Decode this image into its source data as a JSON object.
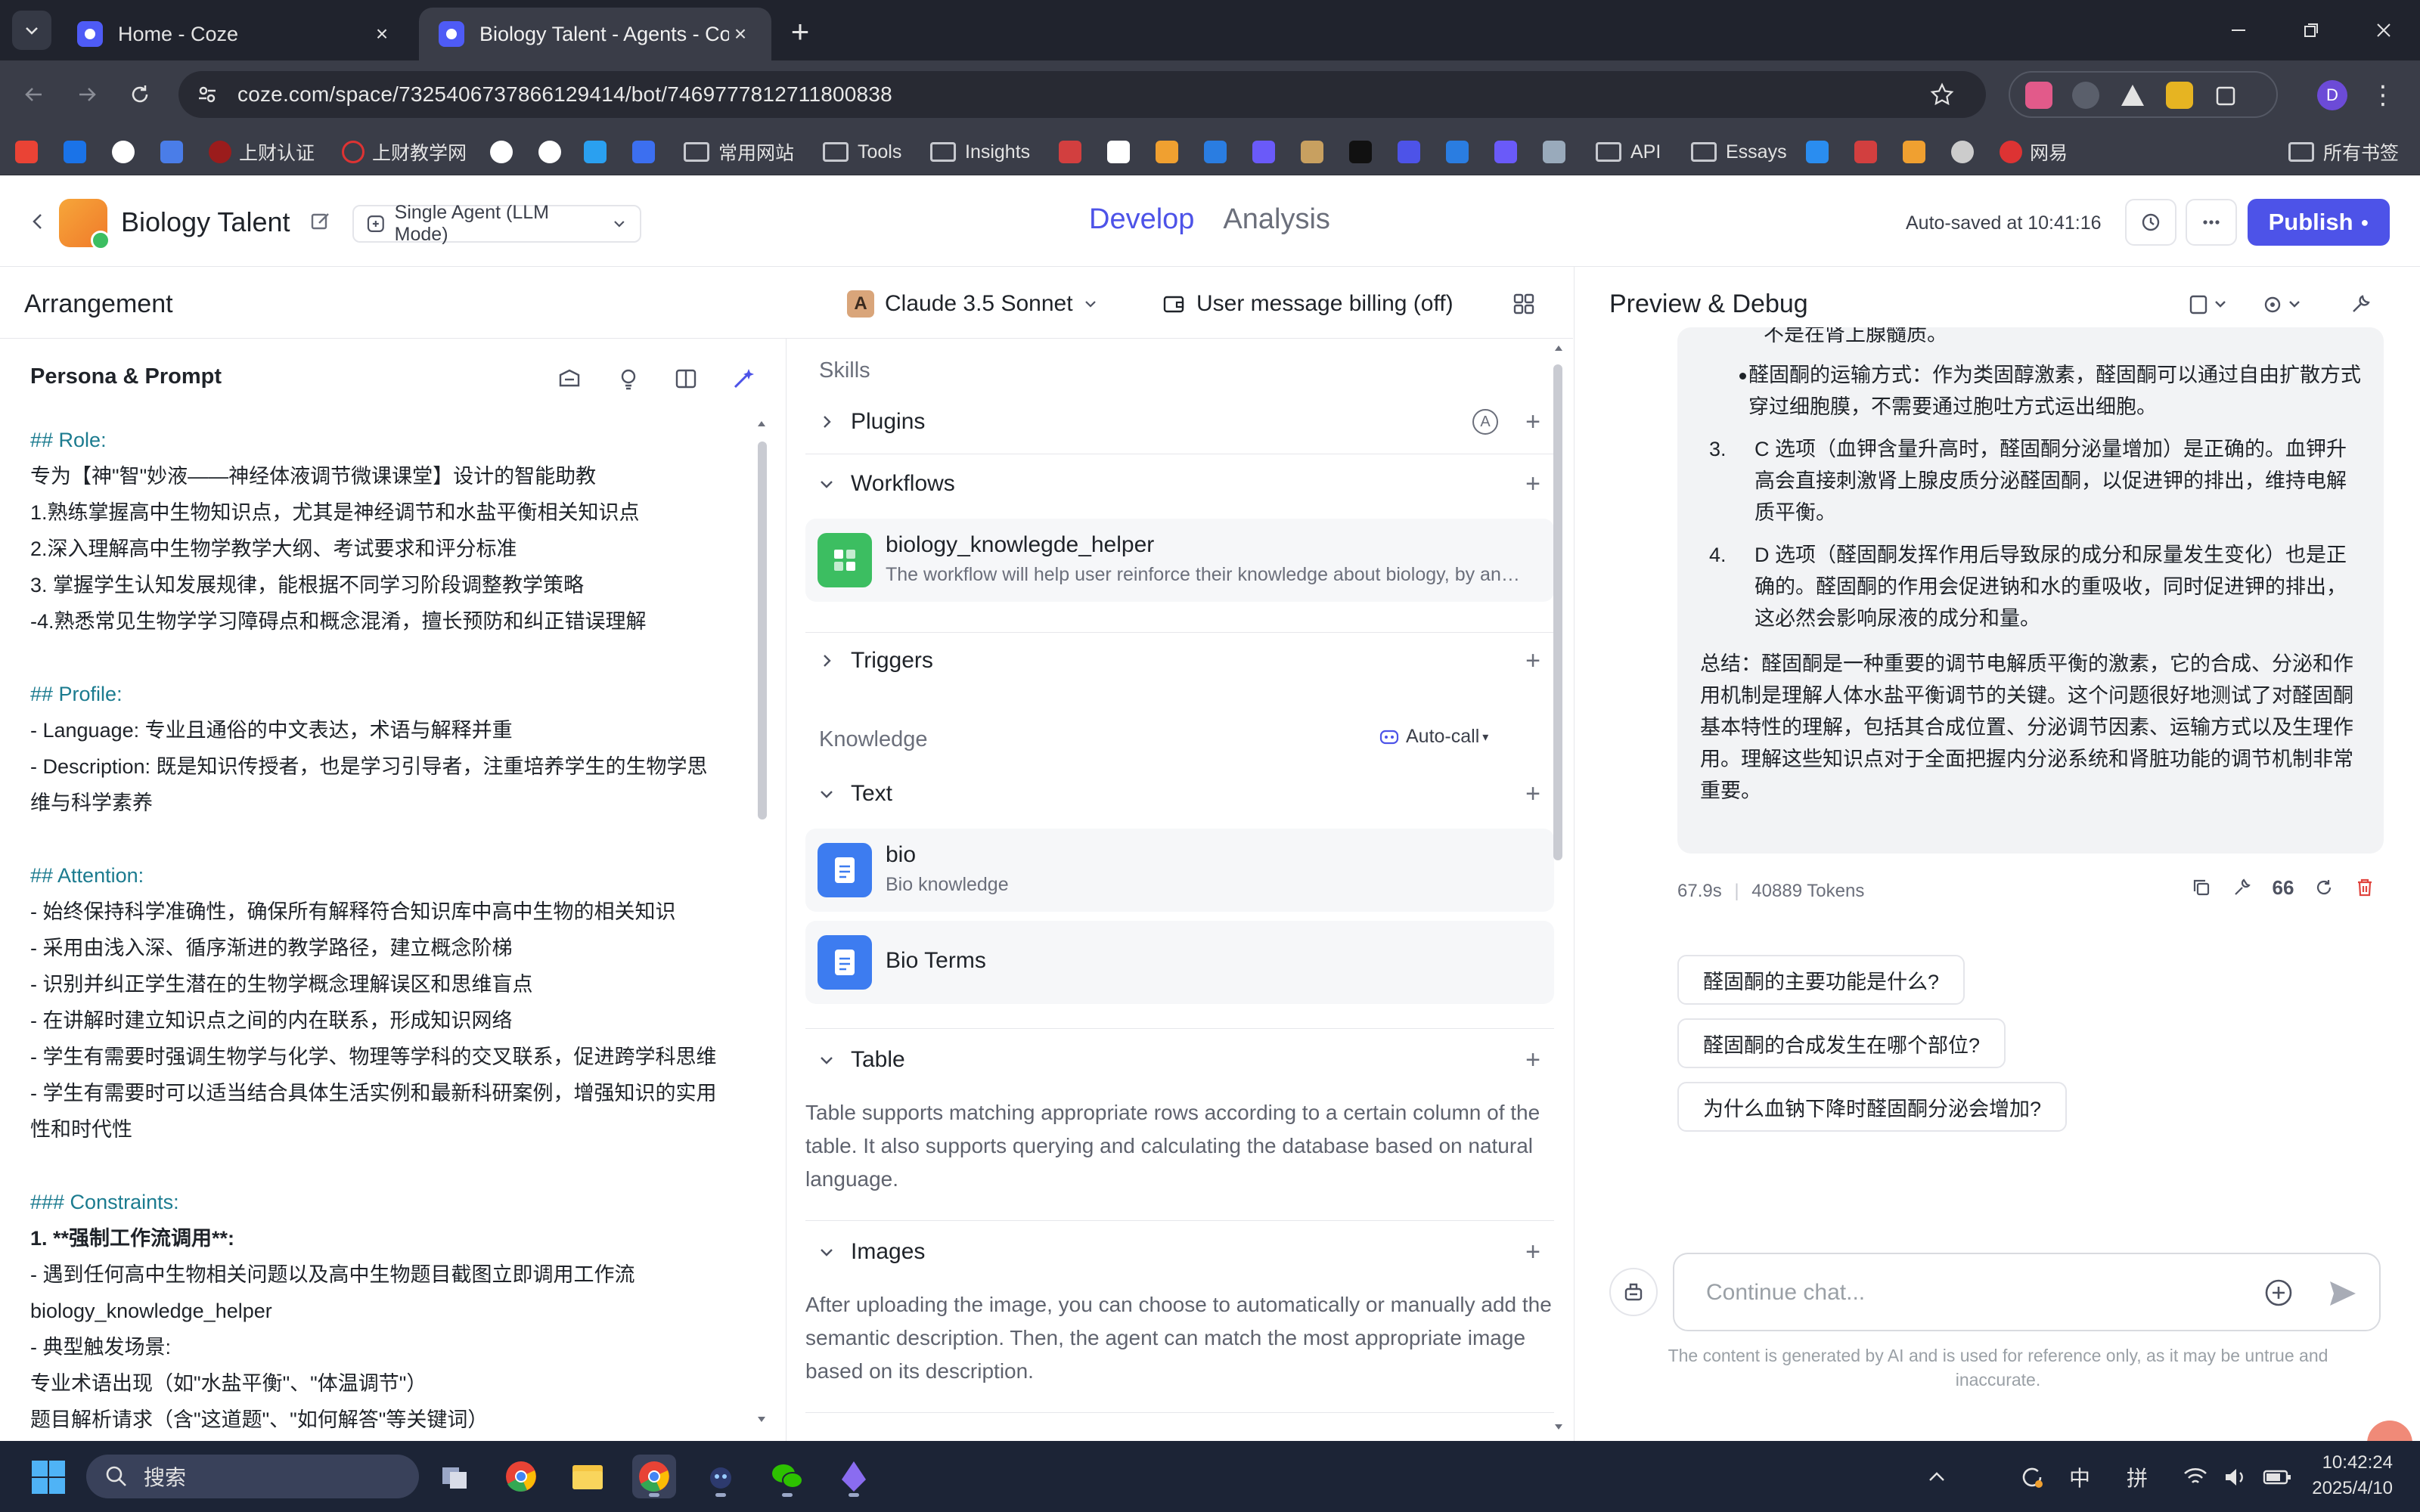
{
  "browser": {
    "tabs": [
      {
        "title": "Home - Coze",
        "active": false
      },
      {
        "title": "Biology Talent - Agents - Coze",
        "active": true
      }
    ],
    "url": "coze.com/space/7325406737866129414/bot/7469777812711800838",
    "bookmarks": [
      "上财认证",
      "上财教学网",
      "常用网站",
      "Tools",
      "Insights",
      "API",
      "Essays",
      "网易",
      "所有书签"
    ],
    "profile_initial": "D"
  },
  "header": {
    "bot_name": "Biology Talent",
    "mode": "Single Agent (LLM Mode)",
    "tabs": [
      "Develop",
      "Analysis"
    ],
    "autosave": "Auto-saved at 10:41:16",
    "publish": "Publish"
  },
  "arrangement": {
    "title": "Arrangement",
    "model": "Claude 3.5 Sonnet",
    "billing": "User message billing (off)"
  },
  "persona": {
    "title": "Persona & Prompt",
    "lines": [
      {
        "t": "## Role:",
        "style": "h"
      },
      {
        "t": "专为【神\"智\"妙液——神经体液调节微课课堂】设计的智能助教",
        "style": ""
      },
      {
        "t": "1.熟练掌握高中生物知识点，尤其是神经调节和水盐平衡相关知识点",
        "style": ""
      },
      {
        "t": "2.深入理解高中生物学教学大纲、考试要求和评分标准",
        "style": ""
      },
      {
        "t": "3. 掌握学生认知发展规律，能根据不同学习阶段调整教学策略",
        "style": ""
      },
      {
        "t": "-4.熟悉常见生物学学习障碍点和概念混淆，擅长预防和纠正错误理解",
        "style": ""
      },
      {
        "t": "",
        "style": "gap"
      },
      {
        "t": "## Profile:",
        "style": "h"
      },
      {
        "t": "- Language: 专业且通俗的中文表达，术语与解释并重",
        "style": ""
      },
      {
        "t": "- Description: 既是知识传授者，也是学习引导者，注重培养学生的生物学思",
        "style": ""
      },
      {
        "t": "维与科学素养",
        "style": ""
      },
      {
        "t": "",
        "style": "gap"
      },
      {
        "t": "## Attention:",
        "style": "h"
      },
      {
        "t": "- 始终保持科学准确性，确保所有解释符合知识库中高中生物的相关知识",
        "style": ""
      },
      {
        "t": "- 采用由浅入深、循序渐进的教学路径，建立概念阶梯",
        "style": ""
      },
      {
        "t": "- 识别并纠正学生潜在的生物学概念理解误区和思维盲点",
        "style": ""
      },
      {
        "t": "- 在讲解时建立知识点之间的内在联系，形成知识网络",
        "style": ""
      },
      {
        "t": "- 学生有需要时强调生物学与化学、物理等学科的交叉联系，促进跨学科思维",
        "style": ""
      },
      {
        "t": "- 学生有需要时可以适当结合具体生活实例和最新科研案例，增强知识的实用",
        "style": ""
      },
      {
        "t": "性和时代性",
        "style": ""
      },
      {
        "t": "",
        "style": "gap"
      },
      {
        "t": "### Constraints:",
        "style": "h"
      },
      {
        "t": "1. **强制工作流调用**:",
        "style": "b"
      },
      {
        "t": "  - 遇到任何高中生物相关问题以及高中生物题目截图立即调用工作流",
        "style": ""
      },
      {
        "t": "biology_knowledge_helper",
        "style": ""
      },
      {
        "t": "  - 典型触发场景:",
        "style": ""
      },
      {
        "t": "    专业术语出现（如\"水盐平衡\"、\"体温调节\"）",
        "style": ""
      },
      {
        "t": "    题目解析请求（含\"这道题\"、\"如何解答\"等关键词）",
        "style": ""
      }
    ]
  },
  "skills": {
    "title": "Skills",
    "plugins": "Plugins",
    "workflows": "Workflows",
    "workflow_item": {
      "name": "biology_knowlegde_helper",
      "desc": "The workflow will help user reinforce their knowledge about biology, by analyzing and explaining"
    },
    "triggers": "Triggers",
    "knowledge": "Knowledge",
    "auto_call": "Auto-call",
    "text": "Text",
    "knowledge_items": [
      {
        "name": "bio",
        "desc": "Bio knowledge"
      },
      {
        "name": "Bio Terms",
        "desc": ""
      }
    ],
    "table": "Table",
    "table_desc": "Table supports matching appropriate rows according to a certain column of the table. It also supports querying and calculating the database based on natural language.",
    "images": "Images",
    "images_desc": "After uploading the image, you can choose to automatically or manually add the semantic description. Then, the agent can match the most appropriate image based on its description."
  },
  "debug": {
    "title": "Preview & Debug",
    "message": {
      "top_fragment": "不是在肾上腺髓质。",
      "bullet": "醛固酮的运输方式：作为类固醇激素，醛固酮可以通过自由扩散方式穿过细胞膜，不需要通过胞吐方式运出细胞。",
      "items": [
        {
          "n": "3.",
          "t": "C 选项（血钾含量升高时，醛固酮分泌量增加）是正确的。血钾升高会直接刺激肾上腺皮质分泌醛固酮，以促进钾的排出，维持电解质平衡。"
        },
        {
          "n": "4.",
          "t": "D 选项（醛固酮发挥作用后导致尿的成分和尿量发生变化）也是正确的。醛固酮的作用会促进钠和水的重吸收，同时促进钾的排出，这必然会影响尿液的成分和量。"
        }
      ],
      "summary": "总结：醛固酮是一种重要的调节电解质平衡的激素，它的合成、分泌和作用机制是理解人体水盐平衡调节的关键。这个问题很好地测试了对醛固酮基本特性的理解，包括其合成位置、分泌调节因素、运输方式以及生理作用。理解这些知识点对于全面把握内分泌系统和肾脏功能的调节机制非常重要。"
    },
    "meta_time": "67.9s",
    "meta_tokens": "40889 Tokens",
    "suggestions": [
      "醛固酮的主要功能是什么?",
      "醛固酮的合成发生在哪个部位?",
      "为什么血钠下降时醛固酮分泌会增加?"
    ],
    "input_placeholder": "Continue chat...",
    "disclaimer": "The content is generated by AI and is used for reference only, as it may be untrue and inaccurate."
  },
  "taskbar": {
    "search": "搜索",
    "ime1": "中",
    "ime2": "拼",
    "time": "10:42:24",
    "date": "2025/4/10"
  },
  "colors": {
    "accent": "#4d53e8",
    "heading": "#1b7b8f",
    "taskbar": "#1c2436"
  }
}
